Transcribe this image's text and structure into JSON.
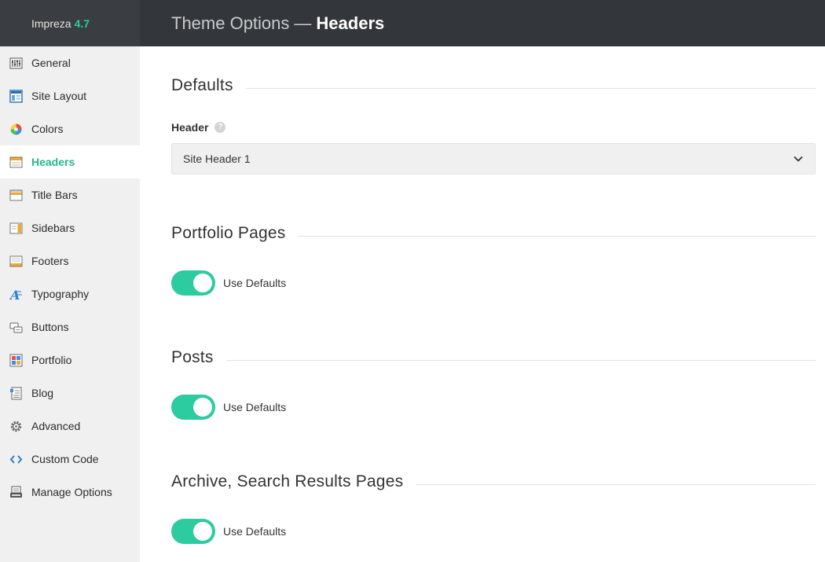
{
  "brand": {
    "name": "Impreza",
    "version": "4.7"
  },
  "header": {
    "prefix": "Theme Options",
    "separator": "—",
    "current": "Headers"
  },
  "sidebar": {
    "items": [
      {
        "label": "General",
        "icon": "general-icon"
      },
      {
        "label": "Site Layout",
        "icon": "site-layout-icon"
      },
      {
        "label": "Colors",
        "icon": "colors-icon"
      },
      {
        "label": "Headers",
        "icon": "headers-icon",
        "active": true
      },
      {
        "label": "Title Bars",
        "icon": "title-bars-icon"
      },
      {
        "label": "Sidebars",
        "icon": "sidebars-icon"
      },
      {
        "label": "Footers",
        "icon": "footers-icon"
      },
      {
        "label": "Typography",
        "icon": "typography-icon"
      },
      {
        "label": "Buttons",
        "icon": "buttons-icon"
      },
      {
        "label": "Portfolio",
        "icon": "portfolio-icon"
      },
      {
        "label": "Blog",
        "icon": "blog-icon"
      },
      {
        "label": "Advanced",
        "icon": "advanced-icon"
      },
      {
        "label": "Custom Code",
        "icon": "custom-code-icon"
      },
      {
        "label": "Manage Options",
        "icon": "manage-options-icon"
      }
    ]
  },
  "main": {
    "defaults": {
      "title": "Defaults",
      "header_label": "Header",
      "help": "?",
      "header_value": "Site Header 1"
    },
    "sections": [
      {
        "title": "Portfolio Pages",
        "toggle_label": "Use Defaults",
        "toggle_on": true
      },
      {
        "title": "Posts",
        "toggle_label": "Use Defaults",
        "toggle_on": true
      },
      {
        "title": "Archive, Search Results Pages",
        "toggle_label": "Use Defaults",
        "toggle_on": true
      }
    ]
  },
  "colors": {
    "accent": "#2ccba0",
    "sidebar_bg": "#f0f0f0",
    "topbar_bg": "#33373b"
  }
}
